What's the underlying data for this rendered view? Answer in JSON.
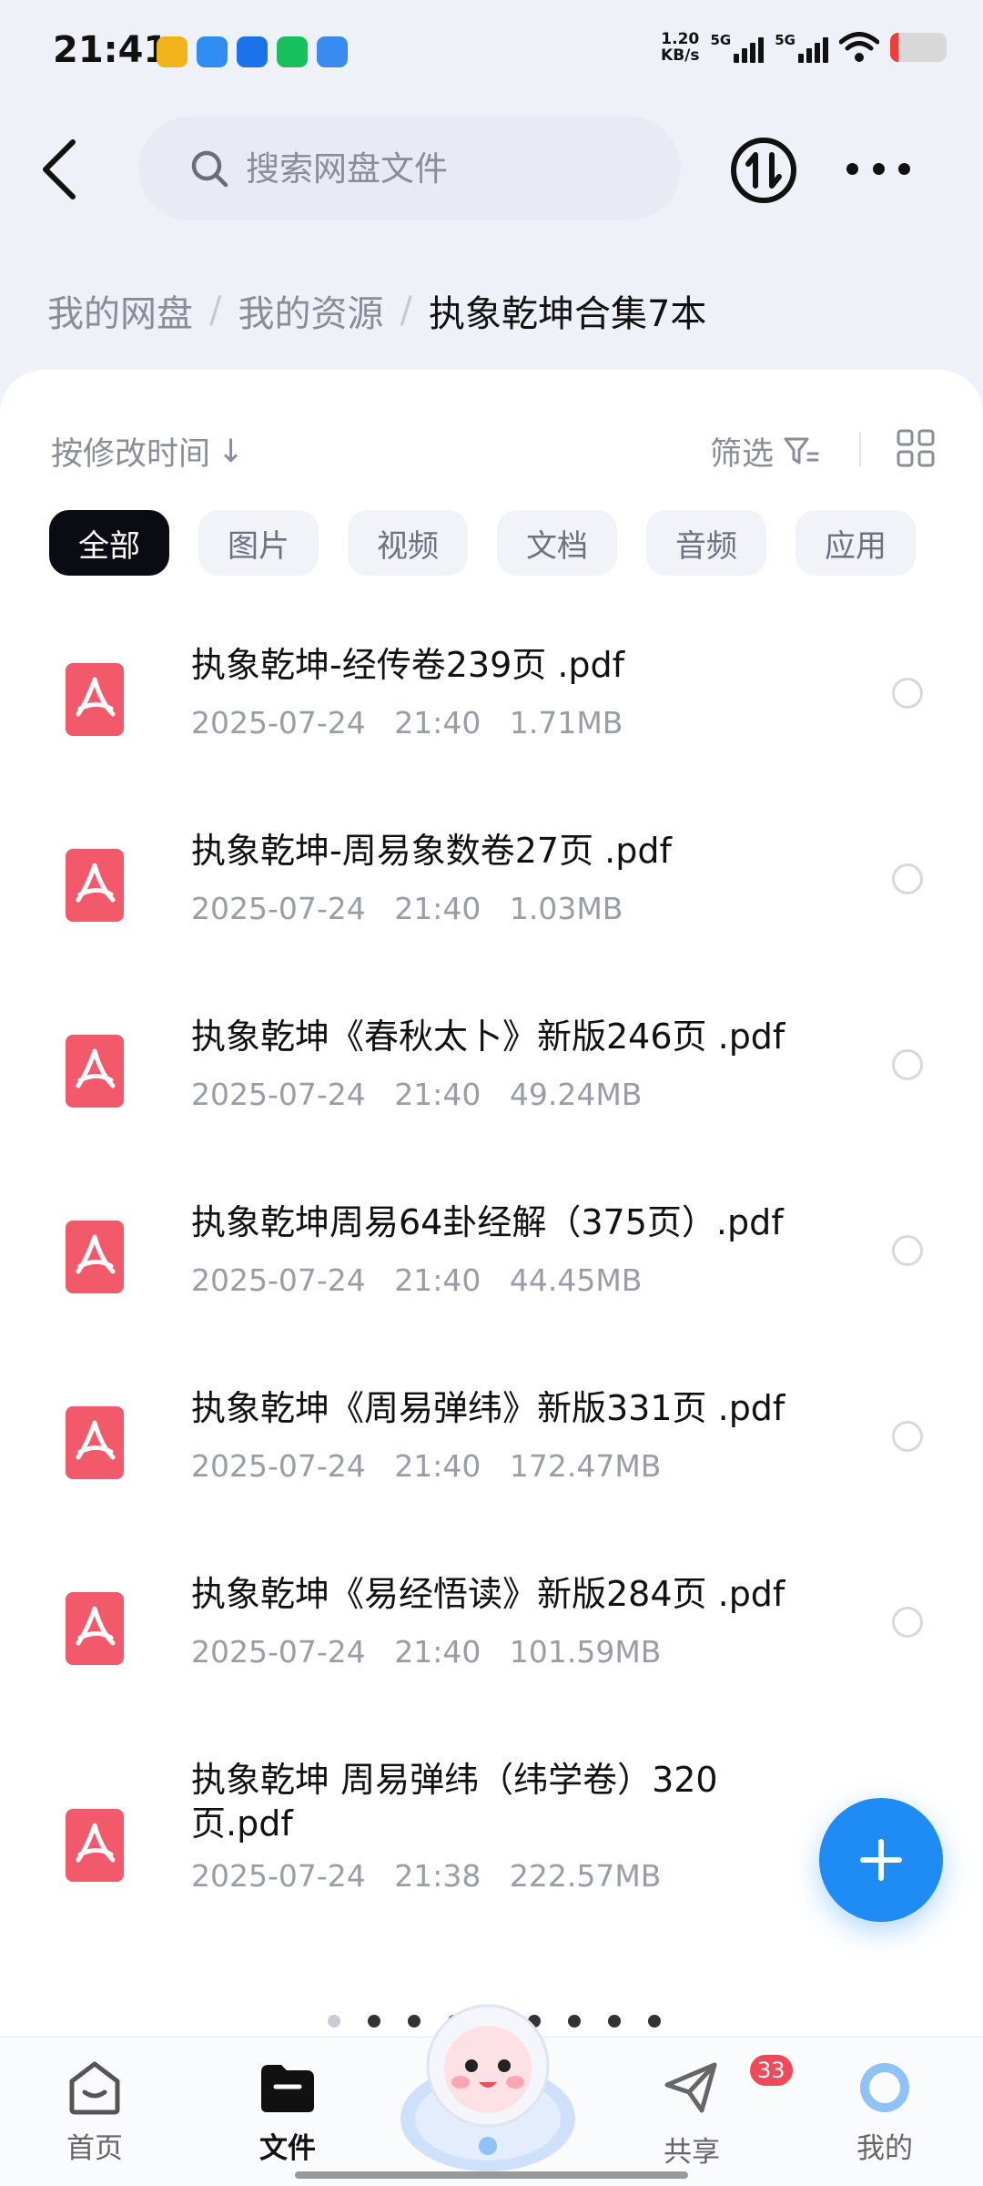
{
  "status_bar": {
    "time": "21:41",
    "net_speed_value": "1.20",
    "net_speed_unit": "KB/s",
    "signal_1": "5G",
    "signal_2": "5G",
    "battery_level": 0.15
  },
  "header": {
    "search_placeholder": "搜索网盘文件"
  },
  "breadcrumb": {
    "items": [
      "我的网盘",
      "我的资源",
      "执象乾坤合集7本"
    ],
    "separator": "/"
  },
  "toolbar": {
    "sort_label": "按修改时间",
    "sort_arrow": "↓",
    "filter_label": "筛选"
  },
  "categories": [
    "全部",
    "图片",
    "视频",
    "文档",
    "音频",
    "应用"
  ],
  "files": [
    {
      "name": "执象乾坤-经传卷239页 .pdf",
      "date": "2025-07-24",
      "time": "21:40",
      "size": "1.71MB"
    },
    {
      "name": "执象乾坤-周易象数卷27页 .pdf",
      "date": "2025-07-24",
      "time": "21:40",
      "size": "1.03MB"
    },
    {
      "name": "执象乾坤《春秋太卜》新版246页 .pdf",
      "date": "2025-07-24",
      "time": "21:40",
      "size": "49.24MB"
    },
    {
      "name": "执象乾坤周易64卦经解（375页）.pdf",
      "date": "2025-07-24",
      "time": "21:40",
      "size": "44.45MB"
    },
    {
      "name": "执象乾坤《周易弹纬》新版331页 .pdf",
      "date": "2025-07-24",
      "time": "21:40",
      "size": "172.47MB"
    },
    {
      "name": "执象乾坤《易经悟读》新版284页 .pdf",
      "date": "2025-07-24",
      "time": "21:40",
      "size": "101.59MB"
    },
    {
      "name": "执象乾坤 周易弹纬（纬学卷）320页.pdf",
      "date": "2025-07-24",
      "time": "21:38",
      "size": "222.57MB"
    }
  ],
  "bottom_nav": {
    "home": "首页",
    "files": "文件",
    "share": "共享",
    "share_badge": "33",
    "mine": "我的"
  },
  "colors": {
    "accent_blue": "#1f8cf5",
    "pdf_red": "#f2596a",
    "chip_active": "#0b0b14",
    "badge_red": "#f04a5a"
  }
}
